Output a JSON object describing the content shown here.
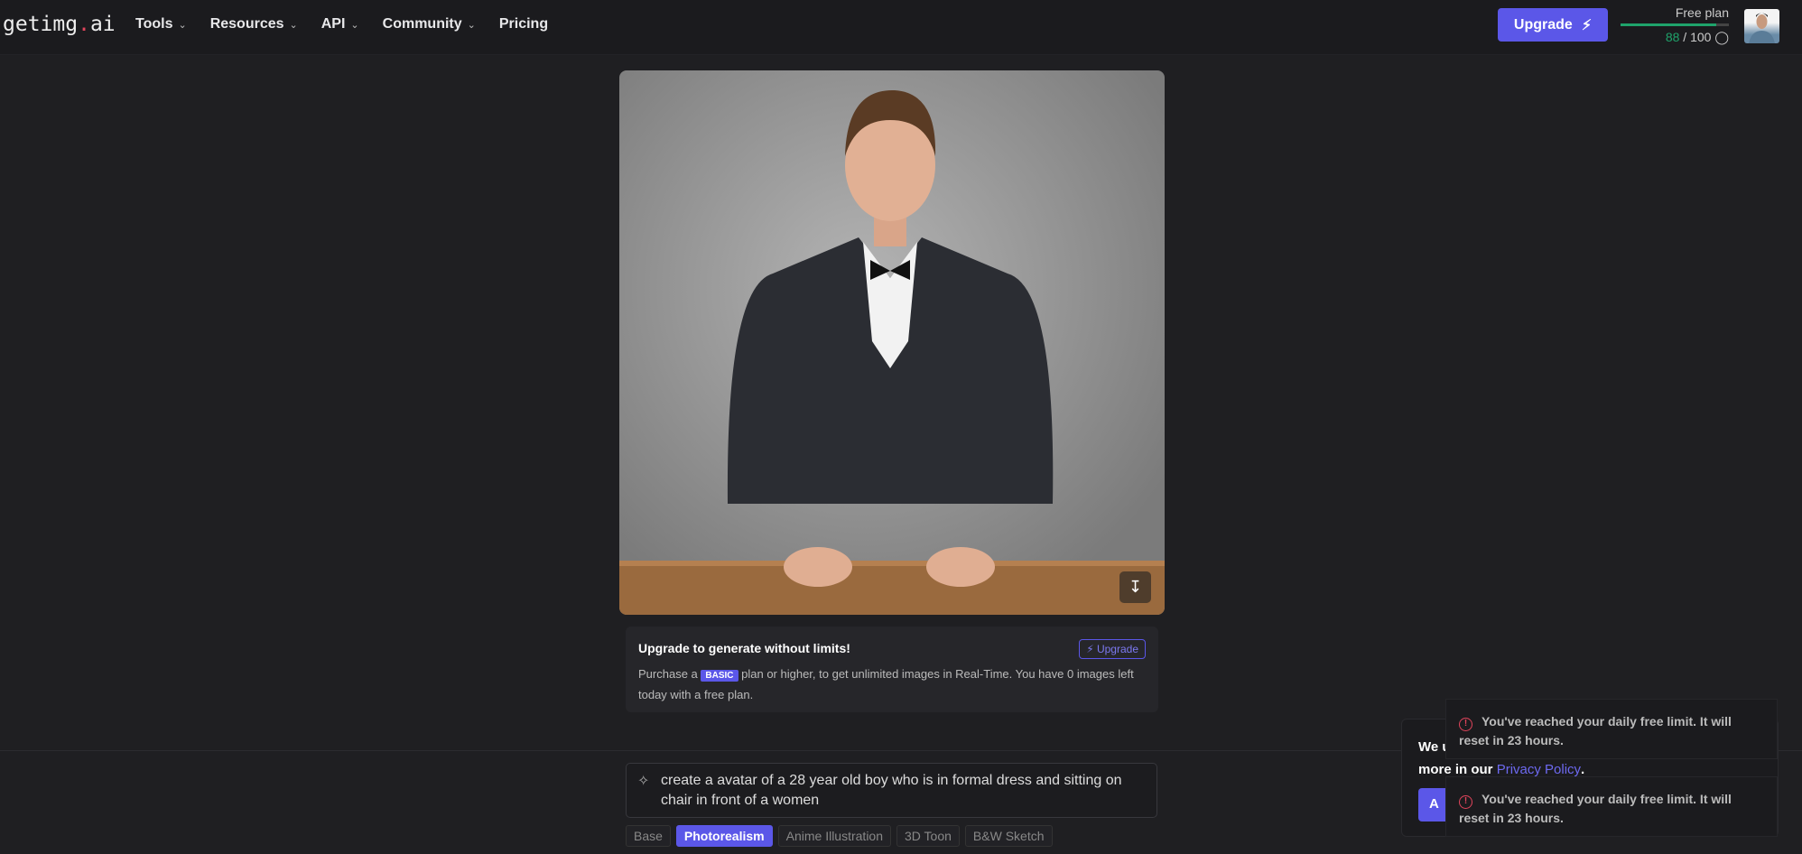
{
  "header": {
    "logo_a": "getimg",
    "logo_dot": ".",
    "logo_b": "ai",
    "nav": [
      {
        "label": "Tools",
        "dropdown": true
      },
      {
        "label": "Resources",
        "dropdown": true
      },
      {
        "label": "API",
        "dropdown": true
      },
      {
        "label": "Community",
        "dropdown": true
      },
      {
        "label": "Pricing",
        "dropdown": false
      }
    ],
    "upgrade_label": "Upgrade",
    "plan_label": "Free plan",
    "credits_used": "88",
    "credits_total": "/ 100",
    "credits_progress": 0.88
  },
  "image": {
    "download_icon": "download-icon"
  },
  "upgrade_card": {
    "title": "Upgrade to generate without limits!",
    "button": "Upgrade",
    "text_pre": "Purchase a",
    "badge": "BASIC",
    "text_post": "plan or higher, to get unlimited images in Real-Time. You have 0 images left today with a free plan."
  },
  "prompt": {
    "value": "create a avatar of a 28 year old boy who is in formal dress and sitting on chair in front of a women"
  },
  "styles": [
    {
      "label": "Base",
      "active": false
    },
    {
      "label": "Photorealism",
      "active": true
    },
    {
      "label": "Anime Illustration",
      "active": false
    },
    {
      "label": "3D Toon",
      "active": false
    },
    {
      "label": "B&W Sketch",
      "active": false
    }
  ],
  "cookie": {
    "text_a": "We u",
    "text_b": "more in our",
    "link": "Privacy Policy",
    "dot": ".",
    "accept": "A"
  },
  "toasts": [
    {
      "text": "You've reached your daily free limit. It will reset in 23 hours."
    },
    {
      "text": "You've reached your daily free limit. It will reset in 23 hours."
    }
  ],
  "colors": {
    "accent": "#5b57e8",
    "success": "#1fa36b",
    "error": "#e0445b"
  }
}
